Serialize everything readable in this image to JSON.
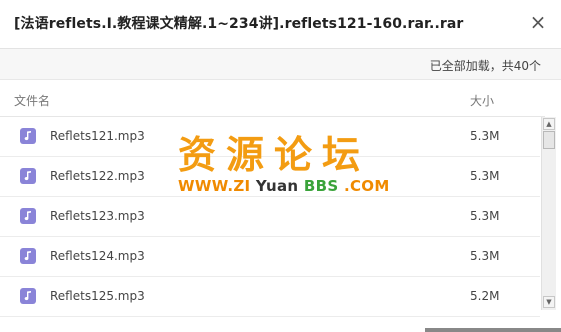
{
  "dialog": {
    "title": "[法语reflets.I.教程课文精解.1~234讲].reflets121-160.rar..rar",
    "close_glyph": "×"
  },
  "summary": {
    "text": "已全部加载，共40个"
  },
  "columns": {
    "name": "文件名",
    "size": "大小"
  },
  "files": [
    {
      "name": "Reflets121.mp3",
      "size": "5.3M"
    },
    {
      "name": "Reflets122.mp3",
      "size": "5.3M"
    },
    {
      "name": "Reflets123.mp3",
      "size": "5.3M"
    },
    {
      "name": "Reflets124.mp3",
      "size": "5.3M"
    },
    {
      "name": "Reflets125.mp3",
      "size": "5.2M"
    }
  ],
  "watermark": {
    "top": "资源论坛",
    "bottom_1": "WWW.",
    "bottom_2": "ZI",
    "bottom_3": " Yuan ",
    "bottom_4": "BBS",
    "bottom_5": " .COM"
  },
  "icons": {
    "file": "music-file-icon",
    "close": "close-icon",
    "scroll_up": "scroll-up-icon",
    "scroll_down": "scroll-down-icon"
  },
  "colors": {
    "file_icon": "#8a84d8",
    "watermark_orange": "#f39c12",
    "watermark_green": "#3aa33a"
  }
}
